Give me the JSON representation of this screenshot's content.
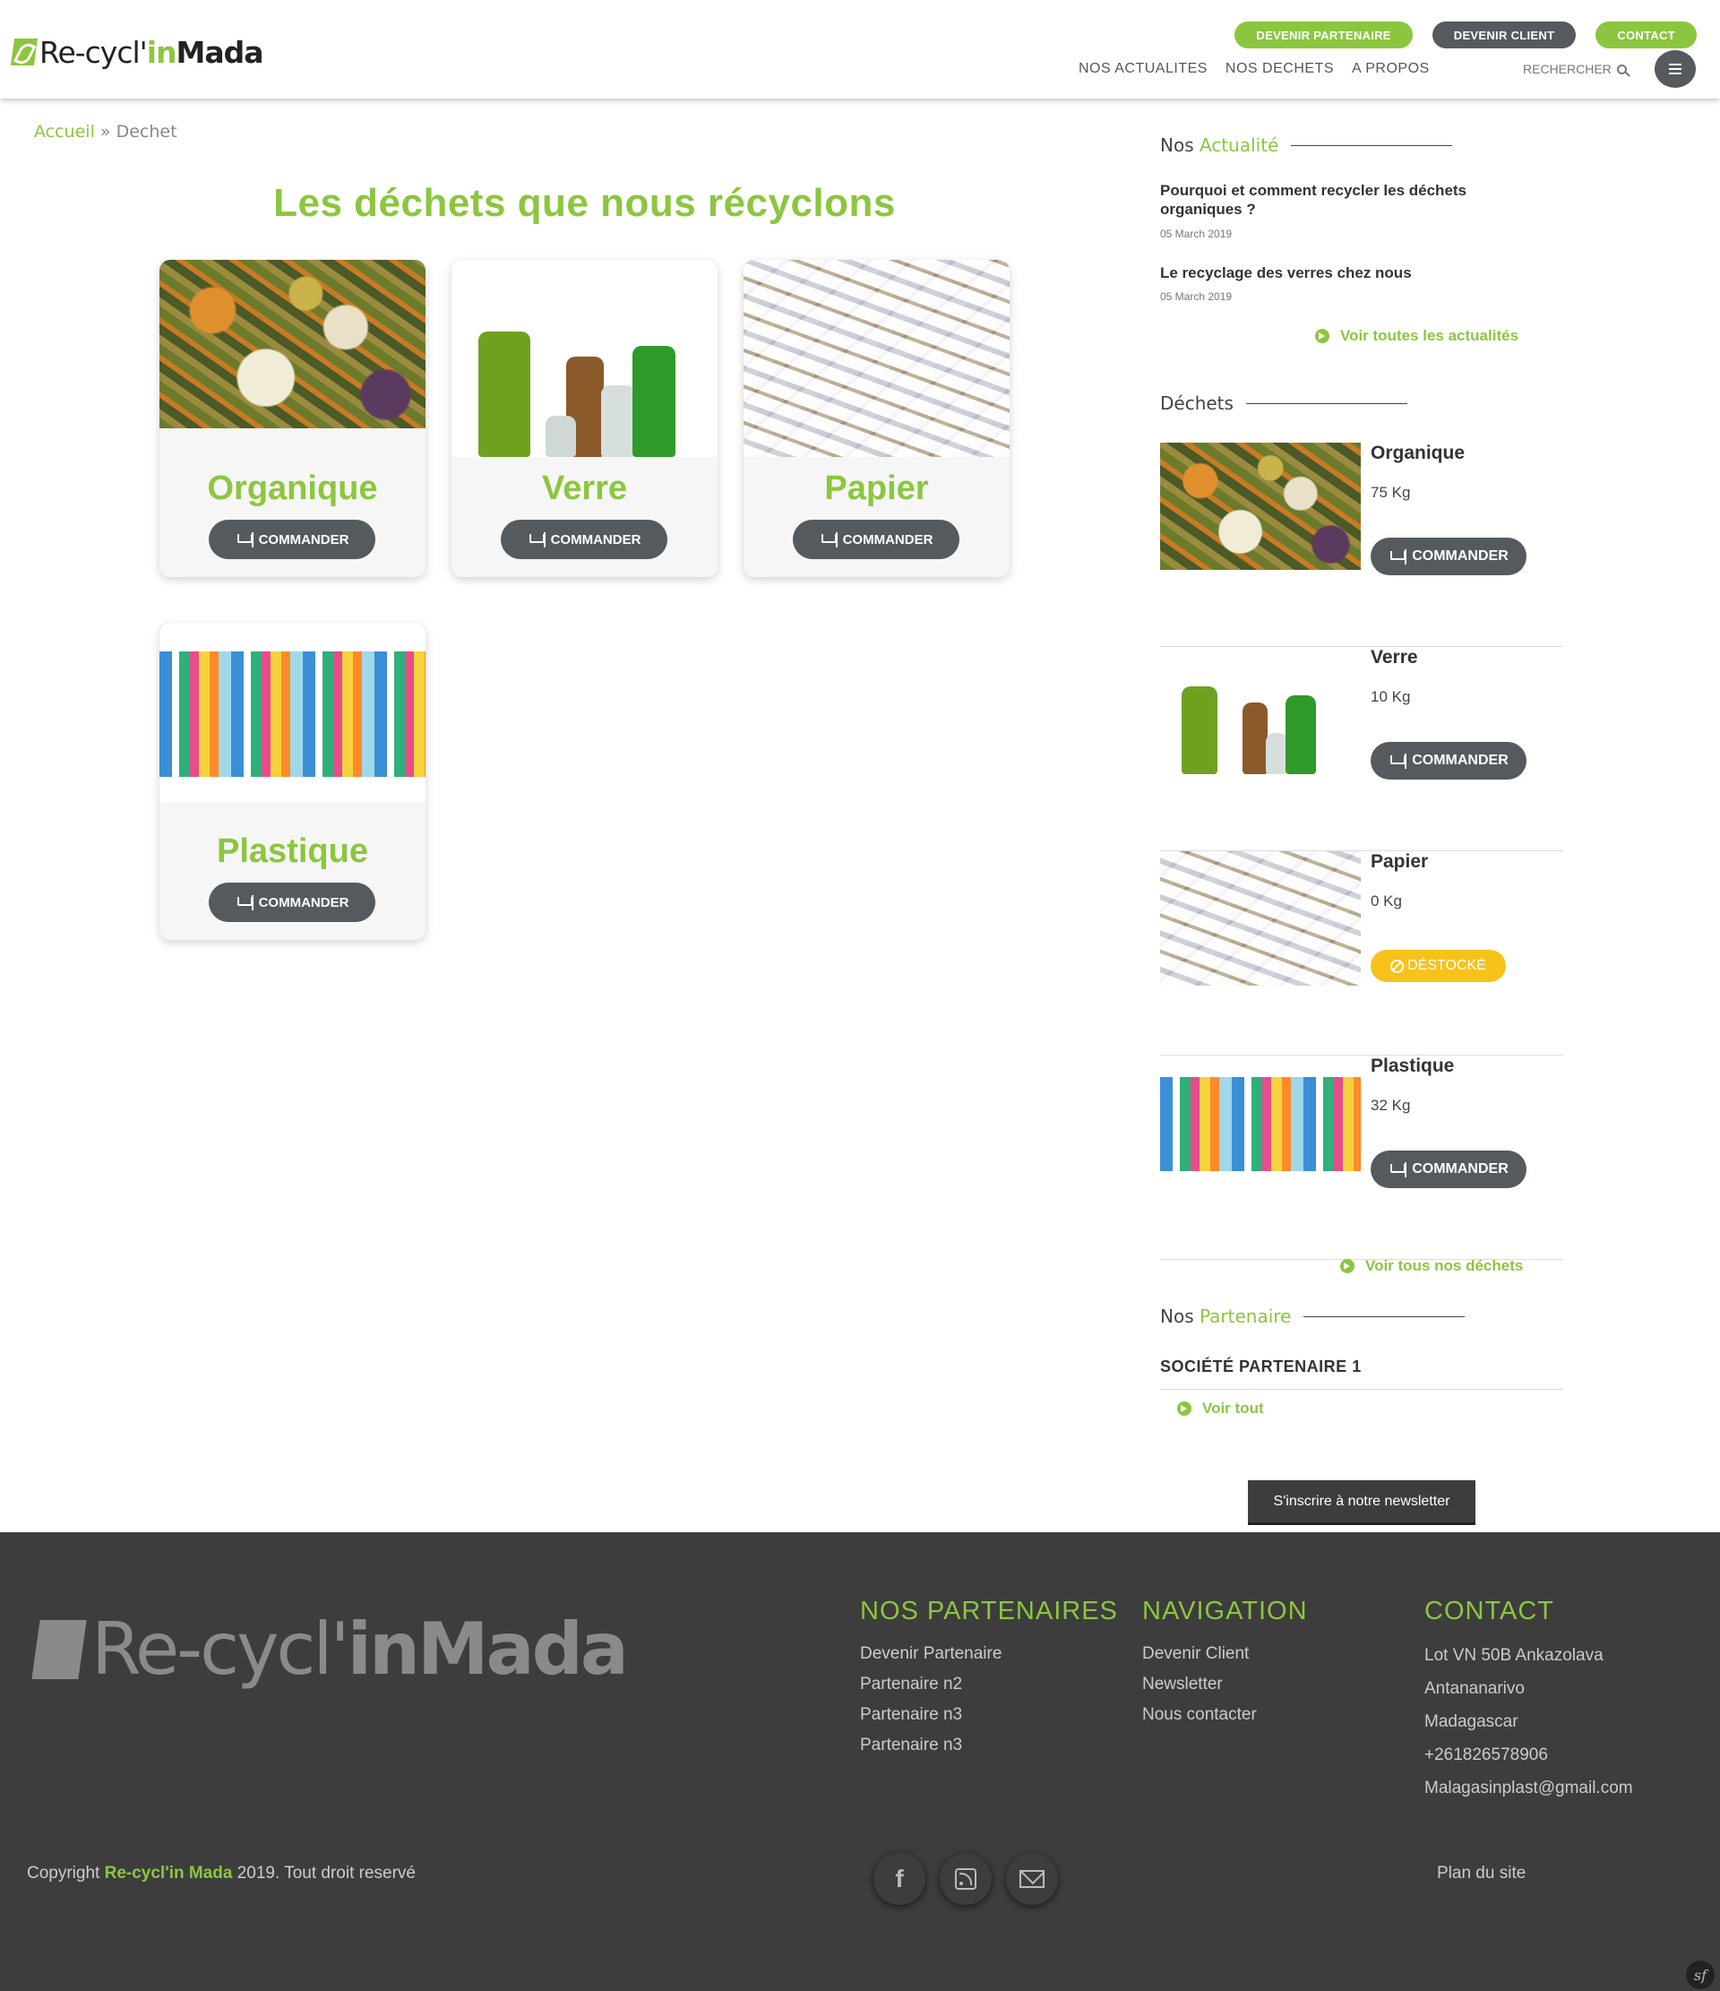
{
  "header": {
    "logo": {
      "part1": "Re-cycl'",
      "part2": "in",
      "part3": "Mada"
    },
    "top_buttons": [
      "DEVENIR PARTENAIRE",
      "DEVENIR CLIENT",
      "CONTACT"
    ],
    "nav": [
      "NOS ACTUALITES",
      "NOS DECHETS",
      "A PROPOS"
    ],
    "search_label": "RECHERCHER"
  },
  "breadcrumb": {
    "home": "Accueil",
    "separator": "»",
    "current": "Dechet"
  },
  "page_title": "Les déchets que nous récyclons",
  "cards": [
    {
      "name": "Organique",
      "button": "COMMANDER"
    },
    {
      "name": "Verre",
      "button": "COMMANDER"
    },
    {
      "name": "Papier",
      "button": "COMMANDER"
    },
    {
      "name": "Plastique",
      "button": "COMMANDER"
    }
  ],
  "sidebar": {
    "news": {
      "heading_a": "Nos",
      "heading_b": "Actualité",
      "items": [
        {
          "title": "Pourquoi et comment recycler les déchets organiques ?",
          "date": "05 March 2019"
        },
        {
          "title": "Le recyclage des verres chez nous",
          "date": "05 March 2019"
        }
      ],
      "more": "Voir toutes les actualités"
    },
    "waste": {
      "heading": "Déchets",
      "items": [
        {
          "name": "Organique",
          "qty": "75 Kg",
          "action": "COMMANDER"
        },
        {
          "name": "Verre",
          "qty": "10 Kg",
          "action": "COMMANDER"
        },
        {
          "name": "Papier",
          "qty": "0 Kg",
          "action": "DÉSTOCKÉ"
        },
        {
          "name": "Plastique",
          "qty": "32 Kg",
          "action": "COMMANDER"
        }
      ],
      "more": "Voir tous nos déchets"
    },
    "partners": {
      "heading_a": "Nos",
      "heading_b": "Partenaire",
      "items": [
        "SOCIÉTÉ PARTENAIRE 1"
      ],
      "more": "Voir tout"
    }
  },
  "newsletter_button": "S'inscrire à notre newsletter",
  "footer": {
    "logo": {
      "part1": "Re-cycl'",
      "part2": "inMada"
    },
    "partners": {
      "title": "NOS PARTENAIRES",
      "items": [
        "Devenir Partenaire",
        "Partenaire n2",
        "Partenaire n3",
        "Partenaire n3"
      ]
    },
    "navigation": {
      "title": "NAVIGATION",
      "items": [
        "Devenir Client",
        "Newsletter",
        "Nous contacter"
      ]
    },
    "contact": {
      "title": "CONTACT",
      "items": [
        "Lot VN 50B Ankazolava",
        "Antananarivo",
        "Madagascar",
        "+261826578906",
        "Malagasinplast@gmail.com"
      ]
    },
    "copyright": {
      "prefix": "Copyright",
      "brand": "Re-cycl'in Mada",
      "suffix": "2019. Tout droit reservé"
    },
    "social": [
      "facebook-icon",
      "rss-icon",
      "mail-icon"
    ],
    "sitemap": "Plan du site"
  },
  "colors": {
    "accent": "#8cc63f",
    "dark_button": "#555a5e",
    "warning": "#f7c21b",
    "footer_bg": "#3d3d3d"
  }
}
